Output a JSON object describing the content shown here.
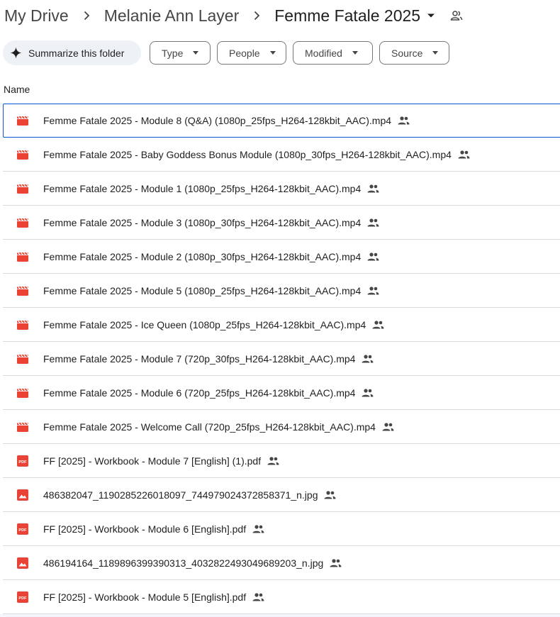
{
  "breadcrumb": {
    "root": "My Drive",
    "parent": "Melanie Ann Layer",
    "current": "Femme Fatale 2025"
  },
  "filters": {
    "summarize_label": "Summarize this folder",
    "chips": [
      "Type",
      "People",
      "Modified",
      "Source"
    ]
  },
  "table": {
    "name_header": "Name"
  },
  "files": [
    {
      "name": "Femme Fatale 2025 - Module 8 (Q&A) (1080p_25fps_H264-128kbit_AAC).mp4",
      "type": "video",
      "shared": true
    },
    {
      "name": "Femme Fatale 2025 - Baby Goddess Bonus Module (1080p_30fps_H264-128kbit_AAC).mp4",
      "type": "video",
      "shared": true
    },
    {
      "name": "Femme Fatale 2025 - Module 1 (1080p_25fps_H264-128kbit_AAC).mp4",
      "type": "video",
      "shared": true
    },
    {
      "name": "Femme Fatale 2025 - Module 3 (1080p_30fps_H264-128kbit_AAC).mp4",
      "type": "video",
      "shared": true
    },
    {
      "name": "Femme Fatale 2025 - Module 2 (1080p_30fps_H264-128kbit_AAC).mp4",
      "type": "video",
      "shared": true
    },
    {
      "name": "Femme Fatale 2025 - Module 5 (1080p_25fps_H264-128kbit_AAC).mp4",
      "type": "video",
      "shared": true
    },
    {
      "name": "Femme Fatale 2025 - Ice Queen (1080p_25fps_H264-128kbit_AAC).mp4",
      "type": "video",
      "shared": true
    },
    {
      "name": "Femme Fatale 2025 - Module 7 (720p_30fps_H264-128kbit_AAC).mp4",
      "type": "video",
      "shared": true
    },
    {
      "name": "Femme Fatale 2025 - Module 6 (720p_25fps_H264-128kbit_AAC).mp4",
      "type": "video",
      "shared": true
    },
    {
      "name": "Femme Fatale 2025 - Welcome Call (720p_25fps_H264-128kbit_AAC).mp4",
      "type": "video",
      "shared": true
    },
    {
      "name": "FF [2025] - Workbook - Module 7 [English] (1).pdf",
      "type": "pdf",
      "shared": true
    },
    {
      "name": "486382047_1190285226018097_744979024372858371_n.jpg",
      "type": "image",
      "shared": true
    },
    {
      "name": "FF [2025] - Workbook - Module 6 [English].pdf",
      "type": "pdf",
      "shared": true
    },
    {
      "name": "486194164_1189896399390313_4032822493049689203_n.jpg",
      "type": "image",
      "shared": true
    },
    {
      "name": "FF [2025] - Workbook - Module 5 [English].pdf",
      "type": "pdf",
      "shared": true
    }
  ],
  "icons": {
    "video": "video-file-icon",
    "pdf": "pdf-file-icon",
    "image": "image-file-icon",
    "shared": "shared-people-icon"
  },
  "colors": {
    "file_red": "#ea4335",
    "selection_border": "#0b57d0",
    "summarize_bg": "#eef2f7"
  },
  "selected_index": 0
}
